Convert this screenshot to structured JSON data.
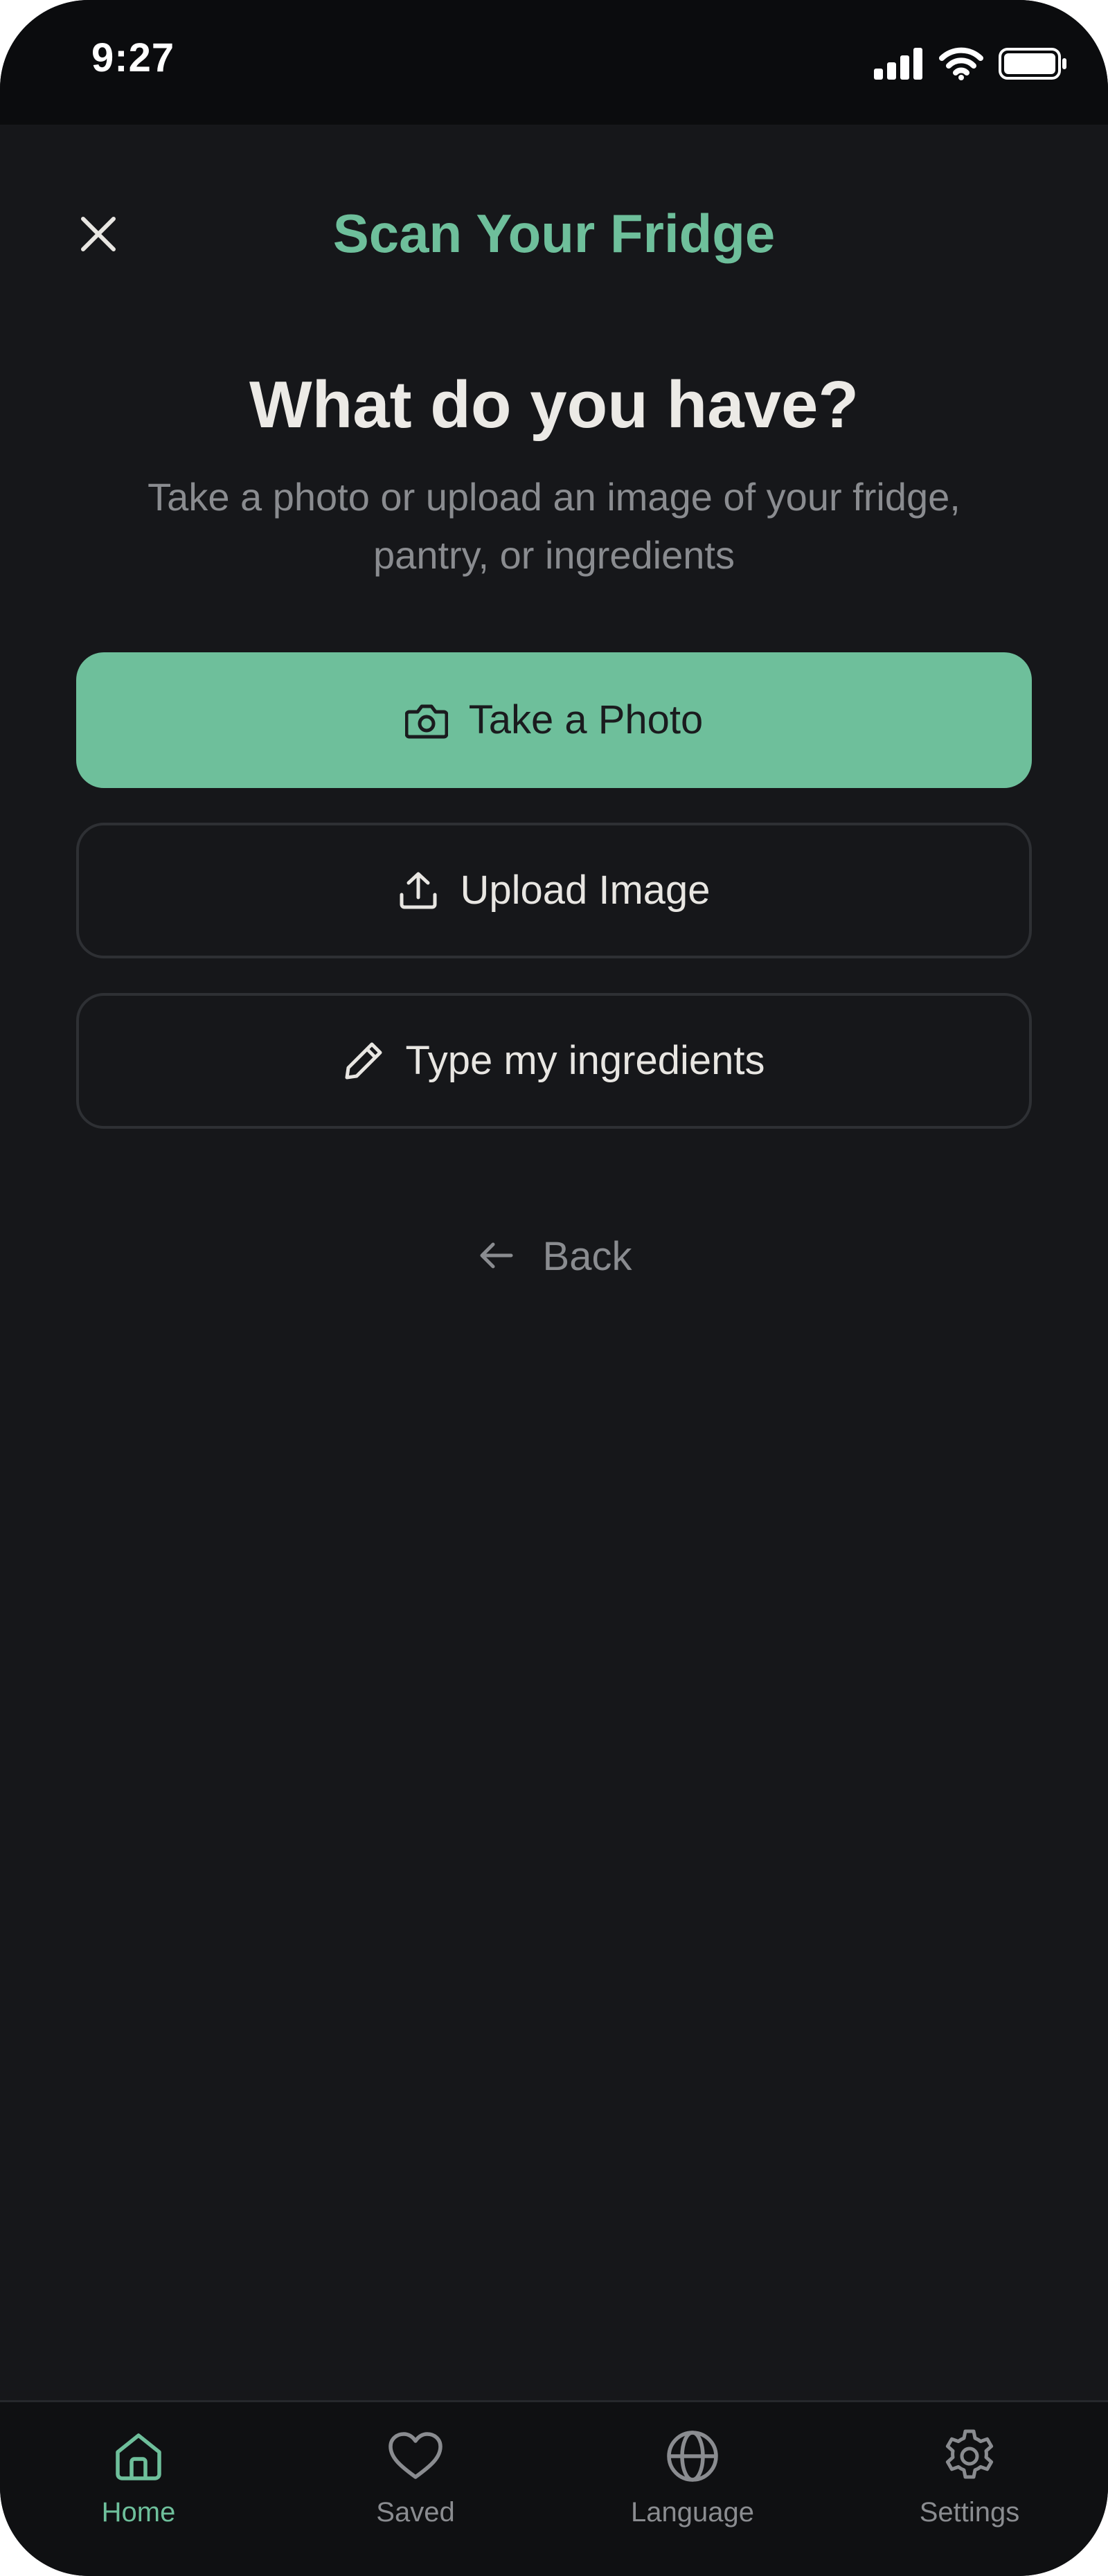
{
  "status_bar": {
    "time": "9:27",
    "icons": [
      "cellular-signal-icon",
      "wifi-icon",
      "battery-icon"
    ]
  },
  "header": {
    "close_icon": "close-icon",
    "title": "Scan Your Fridge"
  },
  "main": {
    "headline": "What do you have?",
    "subtitle": "Take a photo or upload an image of your fridge, pantry, or ingredients",
    "actions": [
      {
        "label": "Take a Photo",
        "icon": "camera-icon",
        "style": "primary"
      },
      {
        "label": "Upload Image",
        "icon": "upload-icon",
        "style": "outline"
      },
      {
        "label": "Type my ingredients",
        "icon": "pencil-icon",
        "style": "outline"
      }
    ],
    "back": {
      "label": "Back",
      "icon": "arrow-left-icon"
    }
  },
  "bottom_nav": {
    "active": "Home",
    "items": [
      {
        "label": "Home",
        "icon": "home-icon"
      },
      {
        "label": "Saved",
        "icon": "heart-icon"
      },
      {
        "label": "Language",
        "icon": "globe-icon"
      },
      {
        "label": "Settings",
        "icon": "gear-icon"
      }
    ]
  },
  "colors": {
    "accent": "#6ebf9b",
    "background": "#16171a",
    "status_bar": "#0b0c0e",
    "muted_text": "#8a8c90"
  }
}
